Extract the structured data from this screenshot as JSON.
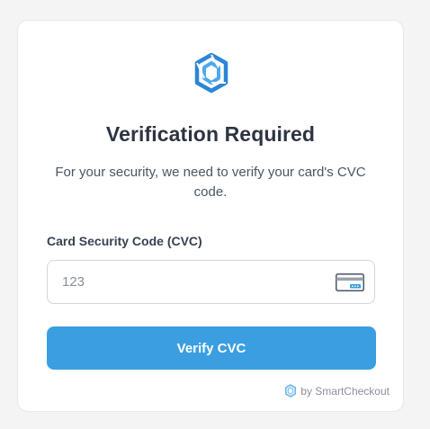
{
  "brand": {
    "logo_icon": "smartcheckout-hexagon-logo",
    "accent_color": "#3b9ee0"
  },
  "header": {
    "title": "Verification Required",
    "subtitle": "For your security, we need to verify your card's CVC code."
  },
  "form": {
    "cvc_label": "Card Security Code (CVC)",
    "cvc_placeholder": "123",
    "cvc_value": "",
    "card_icon": "credit-card-icon",
    "submit_label": "Verify CVC"
  },
  "footer": {
    "text": "by SmartCheckout"
  }
}
